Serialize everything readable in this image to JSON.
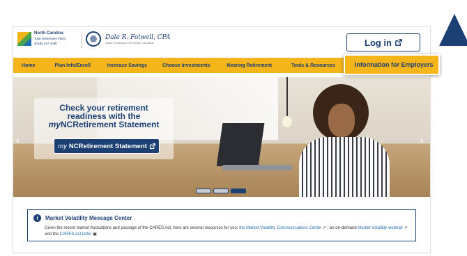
{
  "header": {
    "brand_name": "North Carolina",
    "brand_sub": "Total Retirement Plans",
    "brand_phone": "401(k) 457 403b",
    "treasurer_signature": "Dale R. Folwell, CPA",
    "treasurer_sub": "State Treasurer of North Carolina",
    "login_label": "Log in",
    "login_icon": "external-link-icon"
  },
  "nav": {
    "items": [
      "Home",
      "Plan Info/Enroll",
      "Increase Savings",
      "Choose Investments",
      "Nearing Retirement",
      "Tools & Resources"
    ],
    "employers_label": "Information for Employers"
  },
  "hero": {
    "title_line1": "Check your retirement",
    "title_line2": "readiness with the",
    "title_line3_prefix": "my",
    "title_line3_rest": "NCRetirement Statement",
    "button_prefix": "my",
    "button_rest": "NCRetirement Statement",
    "prev_arrow": "‹",
    "next_arrow": "›"
  },
  "market": {
    "title": "Market Volatility Message Center",
    "text_1": "Given the recent market fluctuations and passage of the CARES Act, here are several resources for you:",
    "link_1": "the Market Volatility Communications Center",
    "text_2": "; an on-demand",
    "link_2": "Market Volatility webinar",
    "text_3": "and the",
    "link_3": "CARES Act letter"
  },
  "colors": {
    "navy": "#1c3f74",
    "gold": "#f4b51b"
  }
}
